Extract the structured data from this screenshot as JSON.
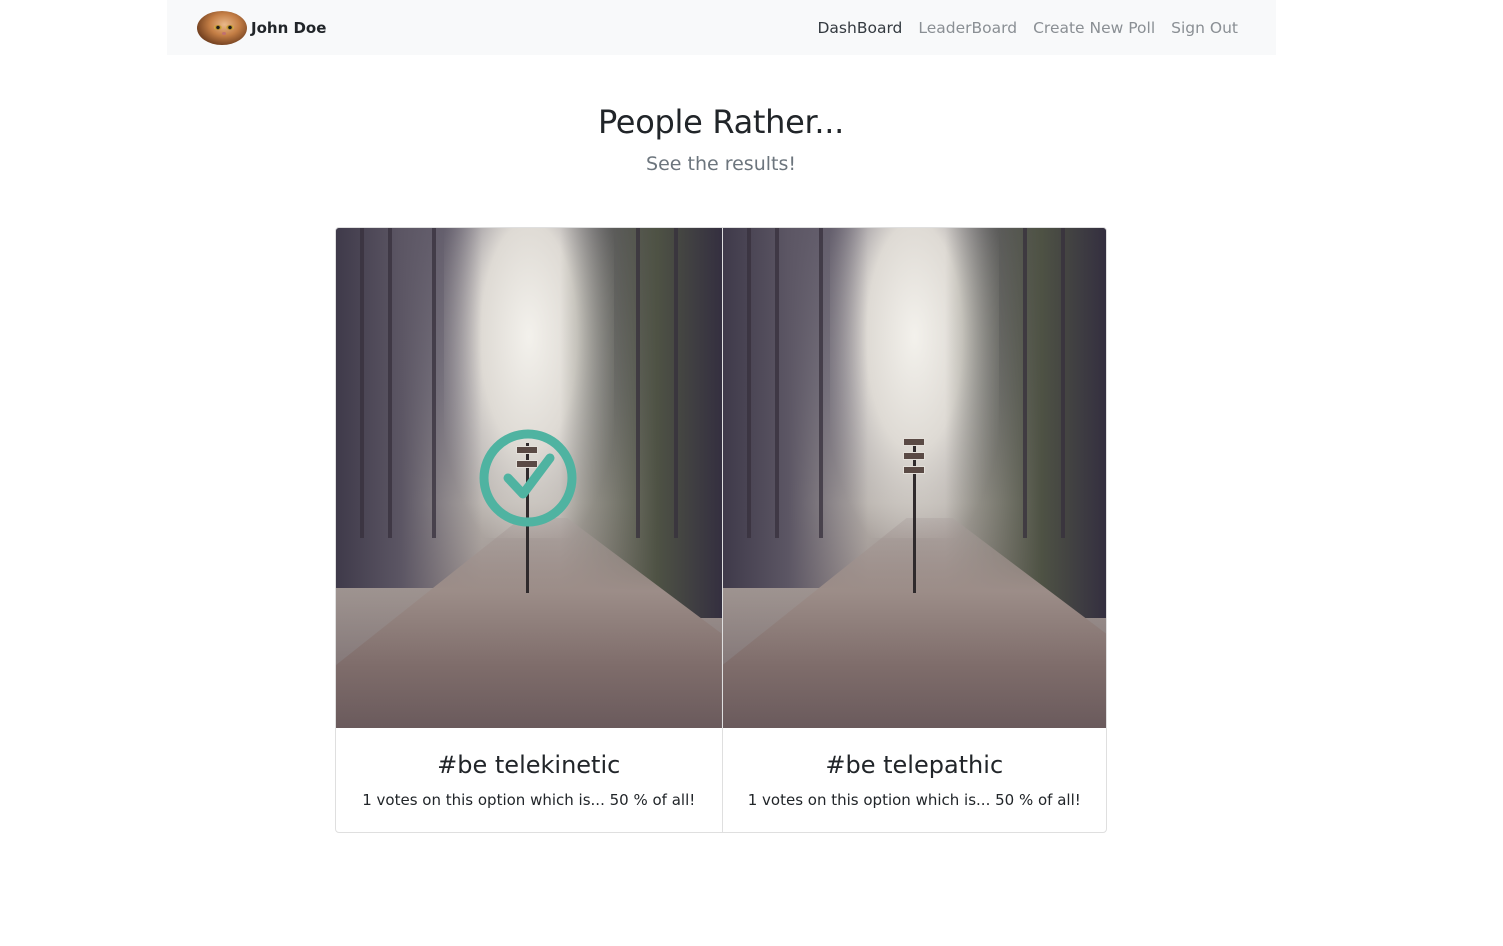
{
  "header": {
    "user_name": "John Doe",
    "nav": [
      {
        "label": "DashBoard",
        "active": true
      },
      {
        "label": "LeaderBoard",
        "active": false
      },
      {
        "label": "Create New Poll",
        "active": false
      },
      {
        "label": "Sign Out",
        "active": false
      }
    ]
  },
  "main": {
    "title": "People Rather...",
    "subtitle": "See the results!"
  },
  "options": [
    {
      "title": "#be telekinetic",
      "result_text": "1 votes on this option which is... 50 % of all!",
      "votes": 1,
      "percent": 50,
      "selected_by_user": true,
      "icon": "check-circle-icon"
    },
    {
      "title": "#be telepathic",
      "result_text": "1 votes on this option which is... 50 % of all!",
      "votes": 1,
      "percent": 50,
      "selected_by_user": false,
      "icon": null
    }
  ],
  "colors": {
    "navbar_bg": "#f8f9fa",
    "check_accent": "#4fb3a1",
    "nav_active": "#343a40",
    "nav_inactive": "#8a8f94",
    "subtitle": "#6c757d"
  }
}
